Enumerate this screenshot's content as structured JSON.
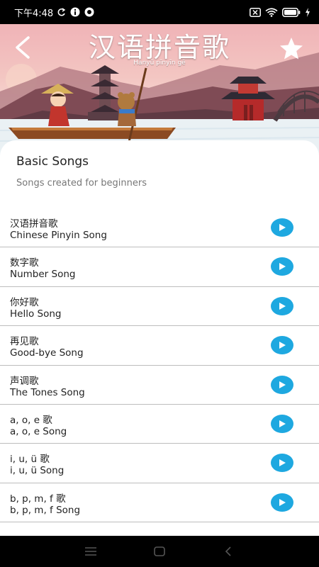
{
  "status_bar": {
    "time": "下午4:48",
    "icons": [
      "sync-icon",
      "info-icon",
      "record-icon",
      "sim-off-icon",
      "wifi-icon",
      "battery-icon",
      "charging-icon"
    ]
  },
  "header": {
    "title": "汉语拼音歌",
    "subtitle": "Hànyǔ pīnyīn gē",
    "back_icon": "chevron-left-icon",
    "favorite_icon": "star-icon"
  },
  "section": {
    "title": "Basic Songs",
    "subtitle": "Songs created for beginners"
  },
  "songs": [
    {
      "cn": "汉语拼音歌",
      "en": "Chinese Pinyin Song"
    },
    {
      "cn": "数字歌",
      "en": "Number Song"
    },
    {
      "cn": "你好歌",
      "en": "Hello Song"
    },
    {
      "cn": "再见歌",
      "en": "Good-bye Song"
    },
    {
      "cn": "声调歌",
      "en": "The Tones Song"
    },
    {
      "cn": "a, o, e 歌",
      "en": "a, o, e Song"
    },
    {
      "cn": "i, u, ü 歌",
      "en": "i, u, ü Song"
    },
    {
      "cn": "b, p, m, f 歌",
      "en": "b, p, m, f Song"
    }
  ],
  "colors": {
    "accent": "#1ea8e0",
    "divider": "#bdbdbd",
    "status_bar": "#000000"
  },
  "nav_bar": {
    "icons": [
      "menu-icon",
      "home-icon",
      "back-icon"
    ]
  }
}
